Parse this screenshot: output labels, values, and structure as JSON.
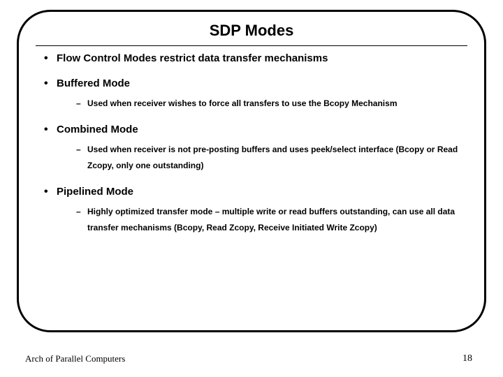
{
  "title": "SDP Modes",
  "bullets": {
    "b0": {
      "text": "Flow Control Modes restrict data transfer mechanisms"
    },
    "b1": {
      "text": "Buffered Mode",
      "sub0": "Used when receiver wishes to force all transfers to use the Bcopy Mechanism"
    },
    "b2": {
      "text": "Combined Mode",
      "sub0": "Used when receiver is not pre-posting buffers and uses peek/select interface  (Bcopy or Read Zcopy, only one outstanding)"
    },
    "b3": {
      "text": "Pipelined Mode",
      "sub0": "Highly optimized transfer mode – multiple write or read buffers outstanding, can use all data transfer mechanisms (Bcopy, Read Zcopy, Receive Initiated Write Zcopy)"
    }
  },
  "footer": {
    "left": "Arch of Parallel Computers",
    "page": "18"
  }
}
